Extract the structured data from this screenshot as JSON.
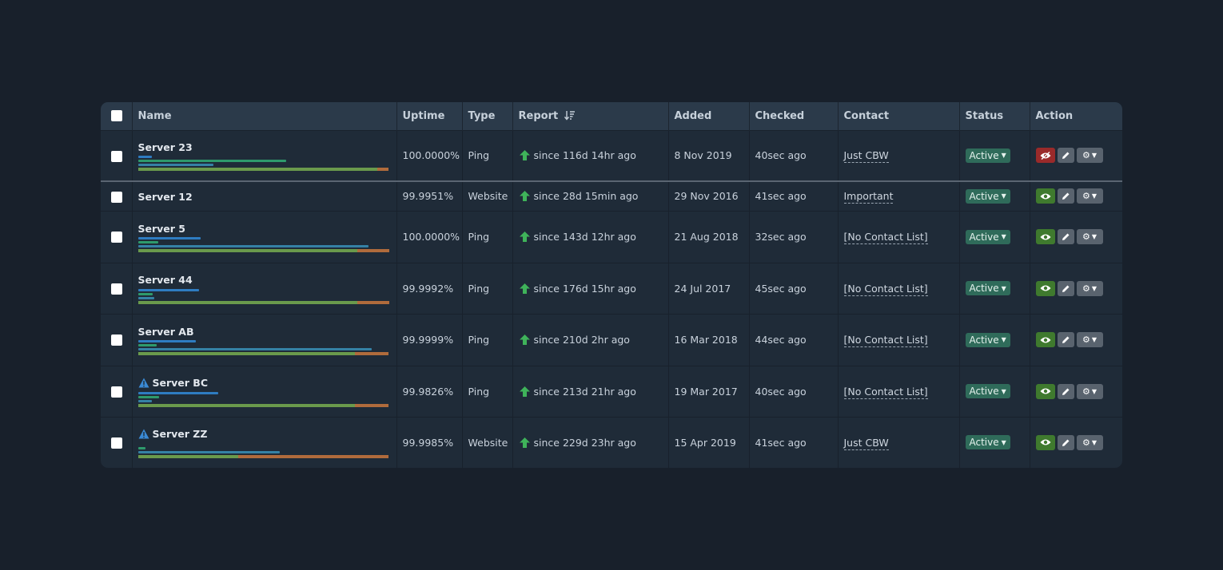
{
  "columns": {
    "name": "Name",
    "uptime": "Uptime",
    "type": "Type",
    "report": "Report",
    "added": "Added",
    "checked": "Checked",
    "contact": "Contact",
    "status": "Status",
    "action": "Action"
  },
  "colors": {
    "bar_blue": "#2e7cc1",
    "bar_green": "#2e9a6c",
    "bar_teal": "#3581a5",
    "bar_olive": "#6a9a4c",
    "bar_orange": "#b06b3c",
    "status_bg": "#2f6b5a",
    "view_on": "#3f7a2e",
    "view_off": "#9a2a2a"
  },
  "rows": [
    {
      "name": "Server 23",
      "warning": false,
      "uptime": "100.0000%",
      "type": "Ping",
      "report": "since 116d 14hr ago",
      "added": "8 Nov 2019",
      "checked": "40sec ago",
      "contact": "Just CBW",
      "status": "Active",
      "view_hidden": true,
      "bars": {
        "blue": 0.055,
        "green": 0.59,
        "teal": 0.3,
        "ok": 0.955
      }
    },
    {
      "name": "Server 12",
      "warning": false,
      "uptime": "99.9951%",
      "type": "Website",
      "report": "since 28d 15min ago",
      "added": "29 Nov 2016",
      "checked": "41sec ago",
      "contact": "Important",
      "status": "Active",
      "view_hidden": false,
      "bars": null
    },
    {
      "name": "Server 5",
      "warning": false,
      "uptime": "100.0000%",
      "type": "Ping",
      "report": "since 143d 12hr ago",
      "added": "21 Aug 2018",
      "checked": "32sec ago",
      "contact": "[No Contact List]",
      "status": "Active",
      "view_hidden": false,
      "bars": {
        "blue": 0.25,
        "green": 0.08,
        "teal": 0.92,
        "ok": 0.875
      }
    },
    {
      "name": "Server 44",
      "warning": false,
      "uptime": "99.9992%",
      "type": "Ping",
      "report": "since 176d 15hr ago",
      "added": "24 Jul 2017",
      "checked": "45sec ago",
      "contact": "[No Contact List]",
      "status": "Active",
      "view_hidden": false,
      "bars": {
        "blue": 0.245,
        "green": 0.06,
        "teal": 0.065,
        "ok": 0.875
      }
    },
    {
      "name": "Server AB",
      "warning": false,
      "uptime": "99.9999%",
      "type": "Ping",
      "report": "since 210d 2hr ago",
      "added": "16 Mar 2018",
      "checked": "44sec ago",
      "contact": "[No Contact List]",
      "status": "Active",
      "view_hidden": false,
      "bars": {
        "blue": 0.23,
        "green": 0.075,
        "teal": 0.93,
        "ok": 0.865
      }
    },
    {
      "name": "Server BC",
      "warning": true,
      "uptime": "99.9826%",
      "type": "Ping",
      "report": "since 213d 21hr ago",
      "added": "19 Mar 2017",
      "checked": "40sec ago",
      "contact": "[No Contact List]",
      "status": "Active",
      "view_hidden": false,
      "bars": {
        "blue": 0.32,
        "green": 0.085,
        "teal": 0.055,
        "ok": 0.865
      }
    },
    {
      "name": "Server ZZ",
      "warning": true,
      "uptime": "99.9985%",
      "type": "Website",
      "report": "since 229d 23hr ago",
      "added": "15 Apr 2019",
      "checked": "41sec ago",
      "contact": "Just CBW",
      "status": "Active",
      "view_hidden": false,
      "bars": {
        "blue": 0.0,
        "green": 0.03,
        "teal": 0.565,
        "ok": 0.4
      }
    }
  ]
}
